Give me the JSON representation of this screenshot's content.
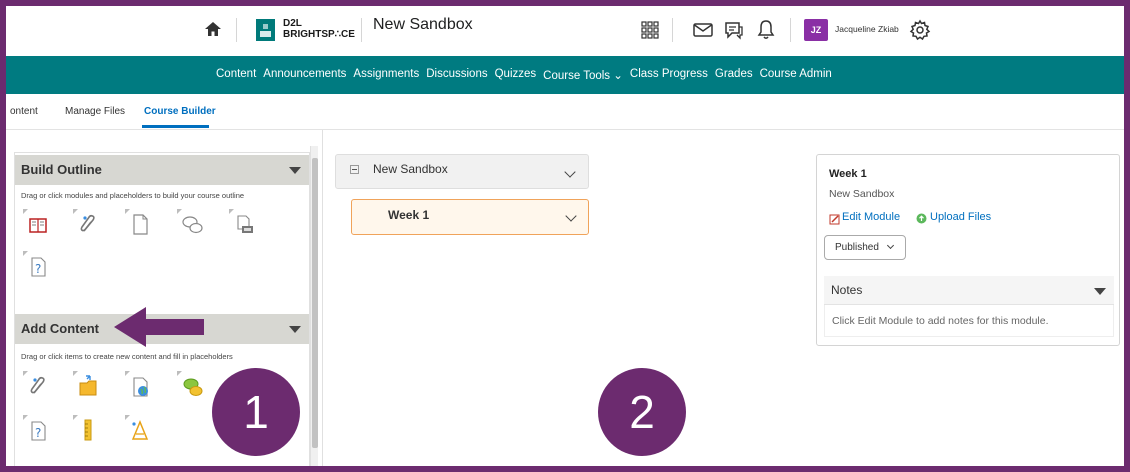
{
  "header": {
    "logo_line1": "D2L",
    "logo_line2": "BRIGHTSP∴CE",
    "course_title": "New Sandbox",
    "user_initials": "JZ",
    "user_name": "Jacqueline Zkiab",
    "avatar_color": "#8a2fa5"
  },
  "nav": {
    "color": "#007b81",
    "items": [
      "Content",
      "Announcements",
      "Assignments",
      "Discussions",
      "Quizzes",
      "Course Tools ⌄",
      "Class Progress",
      "Grades",
      "Course Admin"
    ]
  },
  "subtabs": {
    "items": [
      "ontent",
      "Manage Files",
      "Course Builder"
    ],
    "active": "Course Builder"
  },
  "left_panel": {
    "build_outline": {
      "title": "Build Outline",
      "description": "Drag or click modules and placeholders to build your course outline",
      "tools": [
        "book-icon",
        "paperclip-icon",
        "document-icon",
        "discussion-bubbles-icon",
        "dropbox-icon",
        "quiz-icon"
      ]
    },
    "add_content": {
      "title": "Add Content",
      "description": "Drag or click items to create new content and fill in placeholders",
      "tools": [
        "paperclip-icon",
        "folder-icon",
        "web-page-icon",
        "discussion-bubbles-icon",
        "quiz-icon",
        "ruler-icon",
        "survey-icon"
      ]
    }
  },
  "annotations": {
    "badge_1": "1",
    "badge_2": "2",
    "accent_color": "#6c2b6f"
  },
  "outline": {
    "root": "New Sandbox",
    "module": "Week 1"
  },
  "details": {
    "title": "Week 1",
    "subtitle": "New Sandbox",
    "edit_module": "Edit Module",
    "upload_files": "Upload Files",
    "status": "Published",
    "notes_title": "Notes",
    "notes_text": "Click Edit Module to add notes for this module."
  }
}
